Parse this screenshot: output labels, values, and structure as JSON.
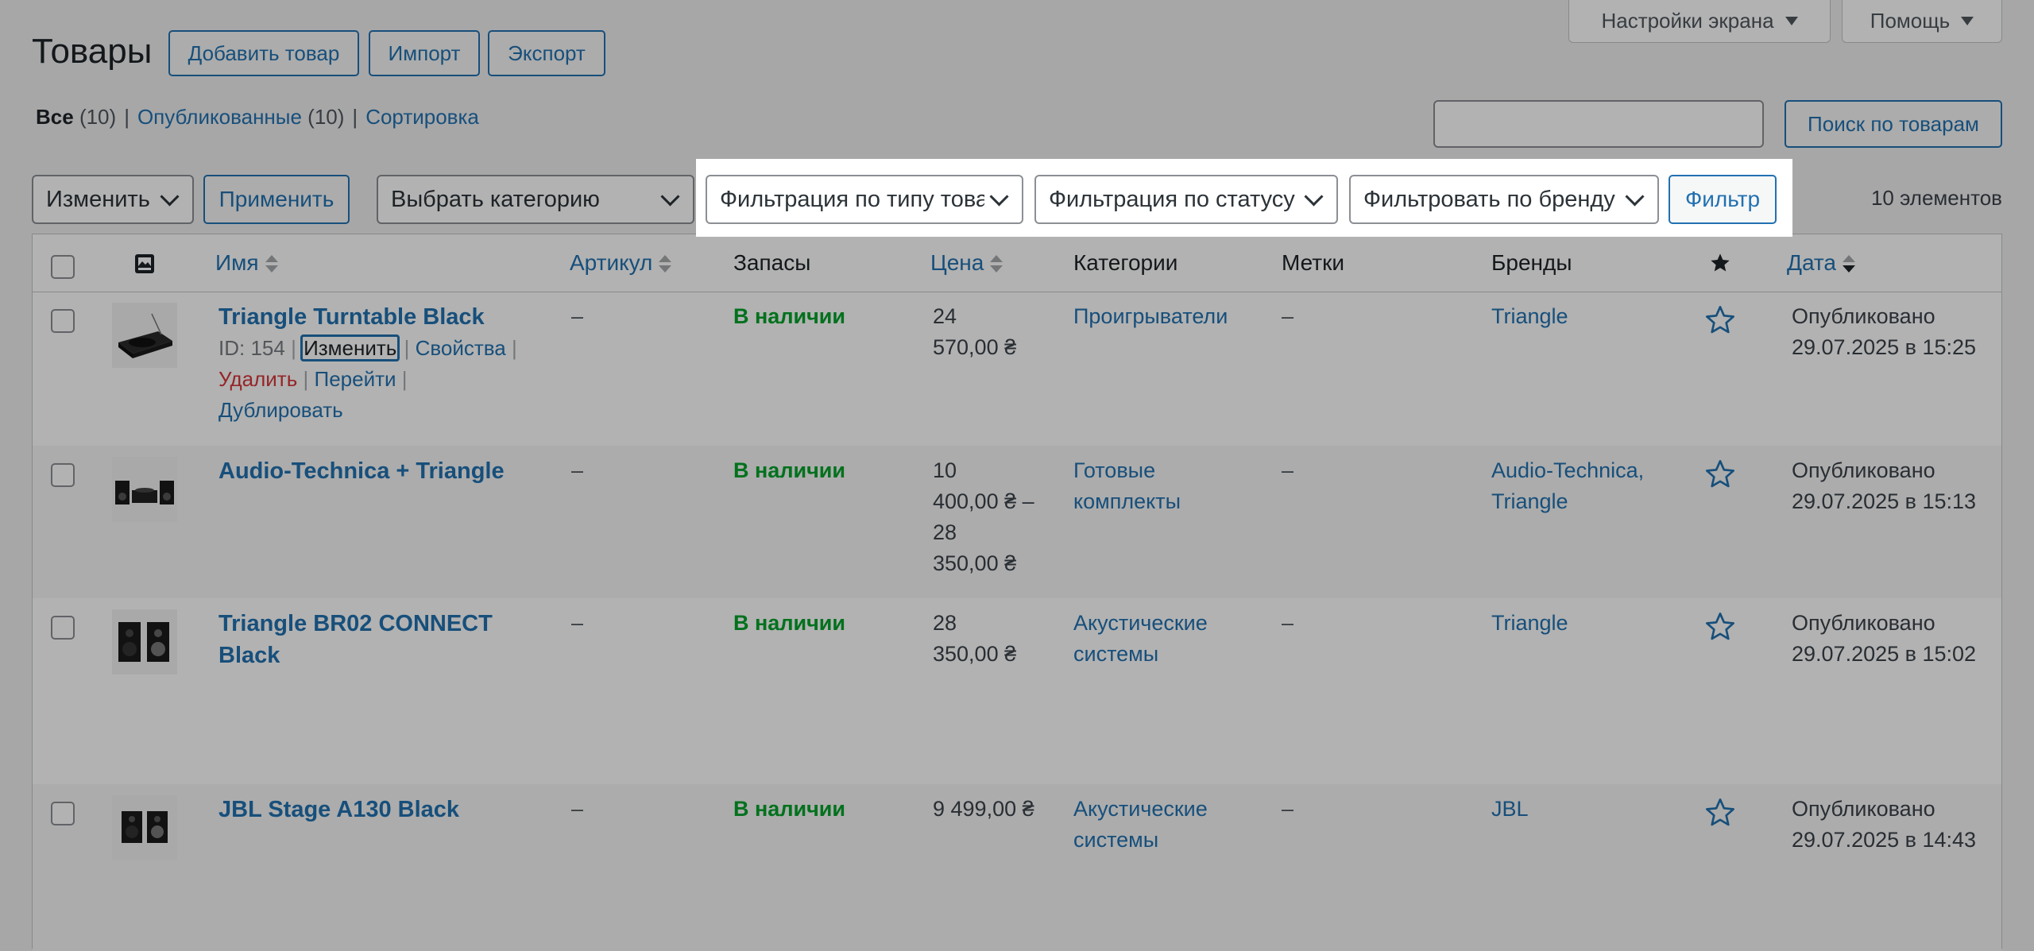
{
  "screen_options": {
    "label": "Настройки экрана"
  },
  "help": {
    "label": "Помощь"
  },
  "page_title": "Товары",
  "title_actions": {
    "add": "Добавить товар",
    "import": "Импорт",
    "export": "Экспорт"
  },
  "views": {
    "all": {
      "label": "Все",
      "count": "(10)"
    },
    "published": {
      "label": "Опубликованные",
      "count": "(10)"
    },
    "sorting": {
      "label": "Сортировка"
    },
    "sep": "|"
  },
  "search": {
    "value": "",
    "button": "Поиск по товарам"
  },
  "bulk": {
    "action": "Изменить",
    "apply": "Применить"
  },
  "filters": {
    "category": "Выбрать категорию",
    "type": "Фильтрация по типу товара",
    "status": "Фильтрация по статусу",
    "brand": "Фильтровать по бренду",
    "submit": "Фильтр"
  },
  "items_count": "10 элементов",
  "columns": {
    "name": "Имя",
    "sku": "Артикул",
    "stock": "Запасы",
    "price": "Цена",
    "categories": "Категории",
    "tags": "Метки",
    "brands": "Бренды",
    "date": "Дата"
  },
  "row_actions": {
    "id": "ID: 154",
    "edit": "Изменить",
    "props": "Свойства",
    "delete": "Удалить",
    "view": "Перейти",
    "duplicate": "Дублировать",
    "sep": "|"
  },
  "products": [
    {
      "name": "Triangle Turntable Black",
      "sku": "–",
      "stock": "В наличии",
      "price_lines": [
        "24",
        "570,00 ₴"
      ],
      "categories": [
        "Проигрыватели"
      ],
      "tags": "–",
      "brands": [
        "Triangle"
      ],
      "date_status": "Опубликовано",
      "date": "29.07.2025 в 15:25",
      "thumb": "turntable-thumbnail"
    },
    {
      "name": "Audio-Technica + Triangle",
      "sku": "–",
      "stock": "В наличии",
      "price_lines": [
        "10",
        "400,00 ₴ –",
        "28",
        "350,00 ₴"
      ],
      "categories": [
        "Готовые",
        "комплекты"
      ],
      "tags": "–",
      "brands": [
        "Audio-Technica,",
        "Triangle"
      ],
      "date_status": "Опубликовано",
      "date": "29.07.2025 в 15:13",
      "thumb": "audio-set-thumbnail"
    },
    {
      "name_lines": [
        "Triangle BR02 CONNECT",
        "Black"
      ],
      "sku": "–",
      "stock": "В наличии",
      "price_lines": [
        "28",
        "350,00 ₴"
      ],
      "categories": [
        "Акустические",
        "системы"
      ],
      "tags": "–",
      "brands": [
        "Triangle"
      ],
      "date_status": "Опубликовано",
      "date": "29.07.2025 в 15:02",
      "thumb": "speakers-thumbnail"
    },
    {
      "name": "JBL Stage A130 Black",
      "sku": "–",
      "stock": "В наличии",
      "price_lines": [
        "9 499,00 ₴"
      ],
      "categories": [
        "Акустические",
        "системы"
      ],
      "tags": "–",
      "brands": [
        "JBL"
      ],
      "date_status": "Опубликовано",
      "date": "29.07.2025 в 14:43",
      "thumb": "bookshelf-speakers-thumbnail"
    }
  ],
  "colors": {
    "link": "#2271b1",
    "in_stock": "#00a32a",
    "delete": "#d63638",
    "background": "#f0f0f1"
  }
}
